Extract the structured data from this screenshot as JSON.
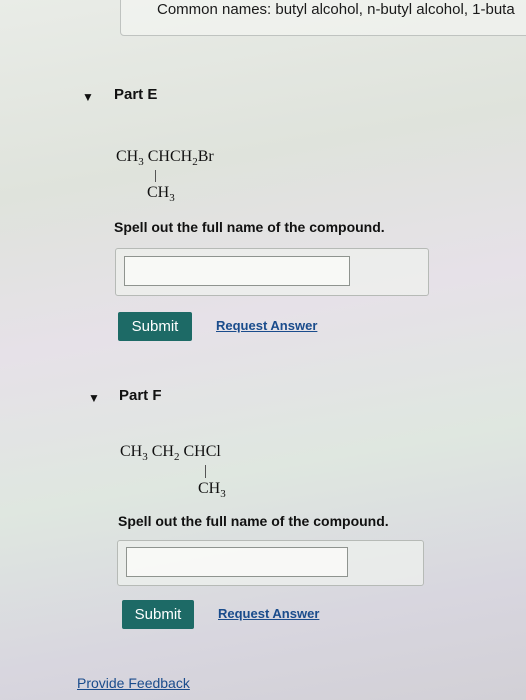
{
  "common_names": "Common names: butyl alcohol, n-butyl alcohol, 1-buta",
  "parts": [
    {
      "title": "Part E",
      "formula_main": [
        "CH",
        "3",
        " CHCH",
        "2",
        "Br"
      ],
      "formula_branch": [
        "CH",
        "3"
      ],
      "instruction": "Spell out the full name of the compound.",
      "answer_value": "",
      "submit_label": "Submit",
      "request_label": "Request Answer"
    },
    {
      "title": "Part F",
      "formula_main": [
        "CH",
        "3",
        " CH",
        "2",
        " CHCl"
      ],
      "formula_branch": [
        "CH",
        "3"
      ],
      "instruction": "Spell out the full name of the compound.",
      "answer_value": "",
      "submit_label": "Submit",
      "request_label": "Request Answer"
    }
  ],
  "feedback_label": "Provide Feedback",
  "icons": {
    "toggle": "caret-down-icon"
  },
  "colors": {
    "submit_bg": "#1d6a66",
    "link": "#1a4c8c"
  }
}
